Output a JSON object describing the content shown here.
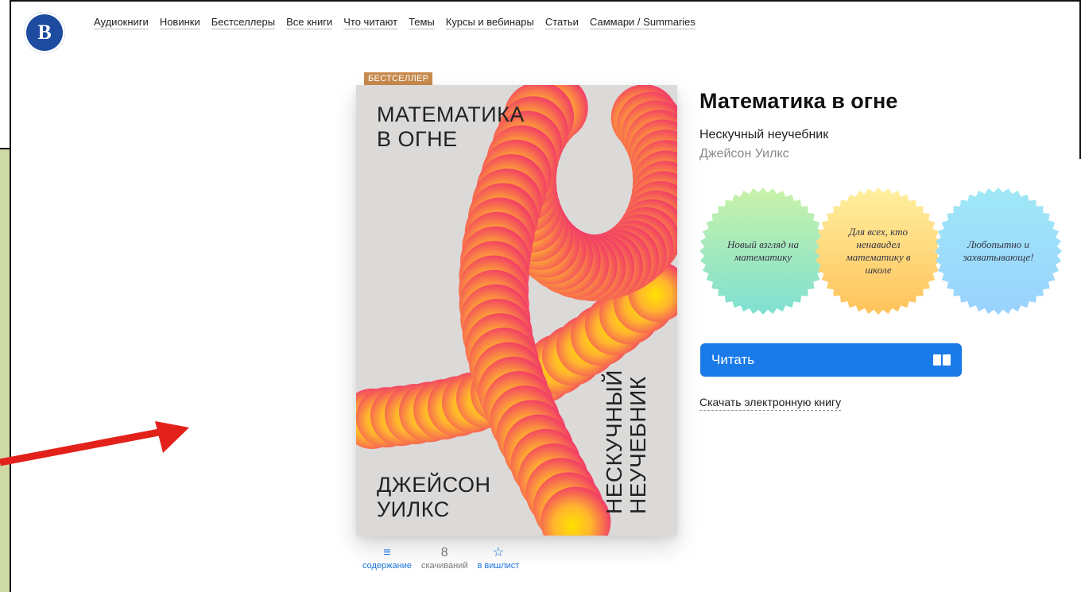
{
  "nav": {
    "logo_alt": "НИУ ВШЭ",
    "items": [
      {
        "label": "Аудиокниги"
      },
      {
        "label": "Новинки"
      },
      {
        "label": "Бестселлеры"
      },
      {
        "label": "Все книги"
      },
      {
        "label": "Что читают"
      },
      {
        "label": "Темы"
      },
      {
        "label": "Курсы и вебинары"
      },
      {
        "label": "Статьи"
      },
      {
        "label": "Саммари / Summaries"
      }
    ]
  },
  "book": {
    "badge": "БЕСТСЕЛЛЕР",
    "title": "Математика в огне",
    "subtitle": "Нескучный неучебник",
    "author": "Джейсон Уилкс",
    "cover": {
      "title": "МАТЕМАТИКА\nВ ОГНЕ",
      "author": "ДЖЕЙСОН\nУИЛКС",
      "subtitle": "НЕСКУЧНЫЙ\nНЕУЧЕБНИК"
    },
    "stats": [
      {
        "top": "≡",
        "label": "содержание",
        "kind": "link"
      },
      {
        "top": "8",
        "label": "скачиваний",
        "kind": "static"
      },
      {
        "top": "☆",
        "label": "в вишлист",
        "kind": "link"
      }
    ],
    "stamps": [
      {
        "text": "Новый взгляд на математику",
        "color_top": "#c9f2a8",
        "color_bottom": "#7fe0d2"
      },
      {
        "text": "Для всех, кто ненавидел математику в школе",
        "color_top": "#fff0a0",
        "color_bottom": "#ffc25a"
      },
      {
        "text": "Любопытно и захватывающе!",
        "color_top": "#9fe8f6",
        "color_bottom": "#9ad2ff"
      }
    ],
    "read_label": "Читать",
    "download_label": "Скачать электронную книгу"
  },
  "colors": {
    "accent": "#1a7be8",
    "badge": "#c88b4e",
    "arrow": "#e3211b"
  }
}
